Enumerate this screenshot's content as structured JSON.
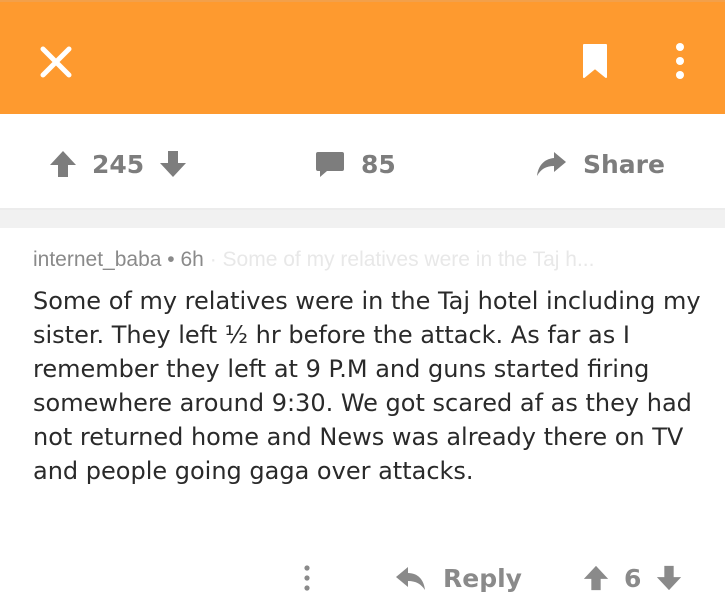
{
  "colors": {
    "header_bg": "#fe9a2f",
    "icon_white": "#ffffff",
    "action_gray": "#7d7d7d"
  },
  "header": {
    "close_icon": "close-icon",
    "bookmark_icon": "bookmark-icon",
    "more_icon": "more-vertical-icon"
  },
  "post_actions": {
    "upvote_icon": "upvote-arrow-icon",
    "score": "245",
    "downvote_icon": "downvote-arrow-icon",
    "comment_icon": "comment-bubble-icon",
    "comment_count": "85",
    "share_icon": "share-arrow-icon",
    "share_label": "Share"
  },
  "comment": {
    "author": "internet_baba",
    "separator": "•",
    "age": "6h",
    "collapsed_preview": "· Some of my relatives were in the Taj h...",
    "body": "Some of my relatives were in the Taj hotel including my sister. They left ½ hr before the attack. As far as I remember they left at 9 P.M and guns started firing somewhere around 9:30. We got scared af as they had not returned home and News was already there on TV and people going gaga over attacks.",
    "actions": {
      "more_icon": "more-vertical-icon",
      "reply_icon": "reply-arrow-icon",
      "reply_label": "Reply",
      "upvote_icon": "upvote-arrow-icon",
      "score": "6",
      "downvote_icon": "downvote-arrow-icon"
    }
  }
}
